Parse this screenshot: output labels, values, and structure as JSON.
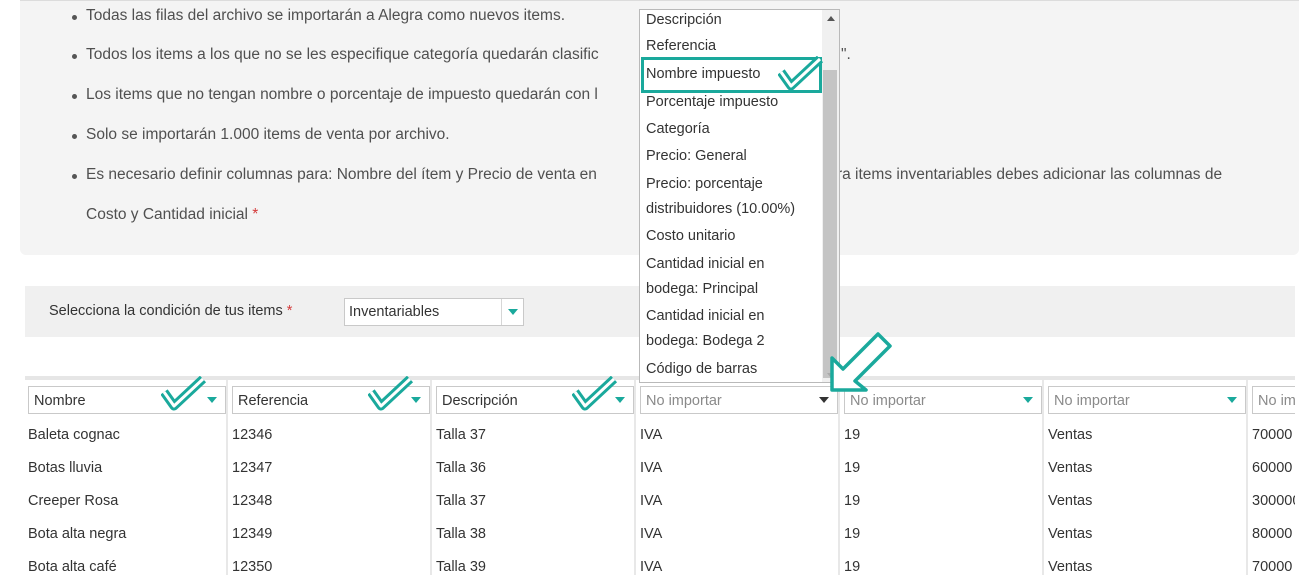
{
  "info": {
    "bullets": [
      "Todas las filas del archivo se importarán a Alegra como nuevos items.",
      "Todos los items a los que no se les especifique categoría quedarán clasific",
      "Los items que no tengan nombre o porcentaje de impuesto quedarán con l",
      "Solo se importarán 1.000 items de venta por archivo.",
      "Es necesario definir columnas para: Nombre del ítem y Precio de venta en",
      "Costo y Cantidad inicial"
    ],
    "bullet2_tail": "\".",
    "bullet5_tail": "Para items inventariables debes adicionar las columnas de",
    "required_mark": "*"
  },
  "condition": {
    "label": "Selecciona la condición de tus items",
    "required_mark": "*",
    "value": "Inventariables"
  },
  "dropdown": {
    "items": [
      "Descripción",
      "Referencia",
      "Nombre impuesto",
      "Porcentaje impuesto",
      "Categoría",
      "Precio: General",
      "Precio: porcentaje",
      "distribuidores (10.00%)",
      "Costo unitario",
      "Cantidad inicial en",
      "bodega: Principal",
      "Cantidad inicial en",
      "bodega: Bodega 2",
      "Código de barras"
    ],
    "highlighted": "Nombre impuesto"
  },
  "columns": [
    "Nombre",
    "Referencia",
    "Descripción",
    "No importar",
    "No importar",
    "No importar",
    "No im"
  ],
  "rows": [
    [
      "Baleta cognac",
      "12346",
      "Talla 37",
      "IVA",
      "19",
      "Ventas",
      "70000"
    ],
    [
      "Botas lluvia",
      "12347",
      "Talla 36",
      "IVA",
      "19",
      "Ventas",
      "60000"
    ],
    [
      "Creeper Rosa",
      "12348",
      "Talla 37",
      "IVA",
      "19",
      "Ventas",
      "300000"
    ],
    [
      "Bota alta negra",
      "12349",
      "Talla 38",
      "IVA",
      "19",
      "Ventas",
      "80000"
    ],
    [
      "Bota alta café",
      "12350",
      "Talla 39",
      "IVA",
      "19",
      "Ventas",
      "70000"
    ]
  ],
  "colors": {
    "accent": "#1aa99c",
    "panel": "#f4f4f4",
    "required": "#d43a3a"
  },
  "icons": [
    "check-annotation-icon",
    "arrow-annotation-icon",
    "dropdown-caret-icon"
  ]
}
